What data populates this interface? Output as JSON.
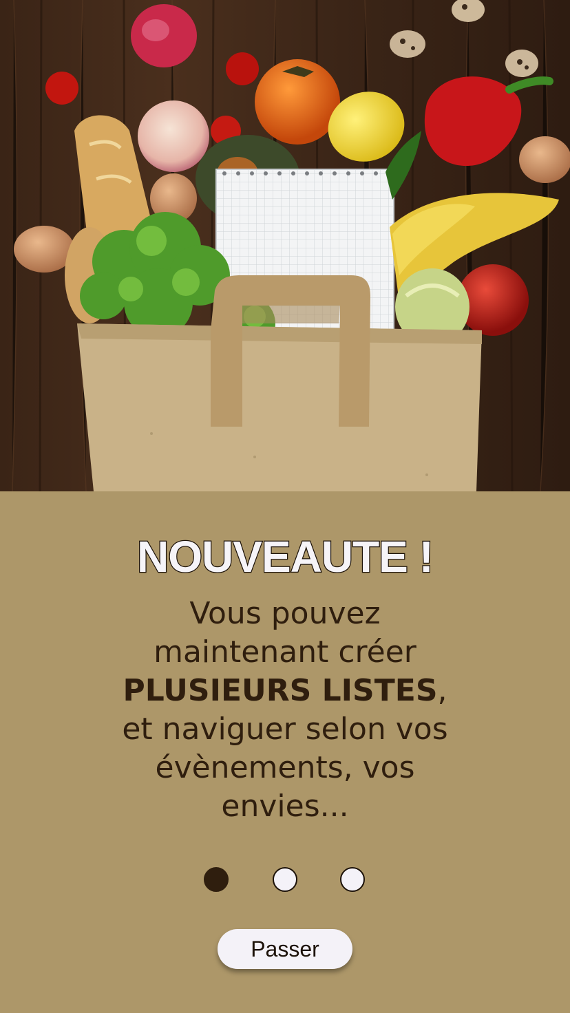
{
  "onboarding": {
    "title": "NOUVEAUTE !",
    "message": {
      "line1": "Vous pouvez",
      "line2": "maintenant créer",
      "emphasis": "PLUSIEURS LISTES",
      "comma": ",",
      "line4": "et naviguer selon vos",
      "line5": "évènements, vos",
      "line6": "envies..."
    },
    "pagination": {
      "current_page": 1,
      "total_pages": 3
    },
    "skip_label": "Passer"
  },
  "hero_image": {
    "subject": "paper grocery bag with vegetables, fruit, bread and a notepad on a dark wooden table"
  },
  "colors": {
    "panel_background": "#ad9769",
    "text_dark": "#2f1e0e",
    "title_fill": "#f6f4f8",
    "button_background": "#f4f2f8"
  }
}
